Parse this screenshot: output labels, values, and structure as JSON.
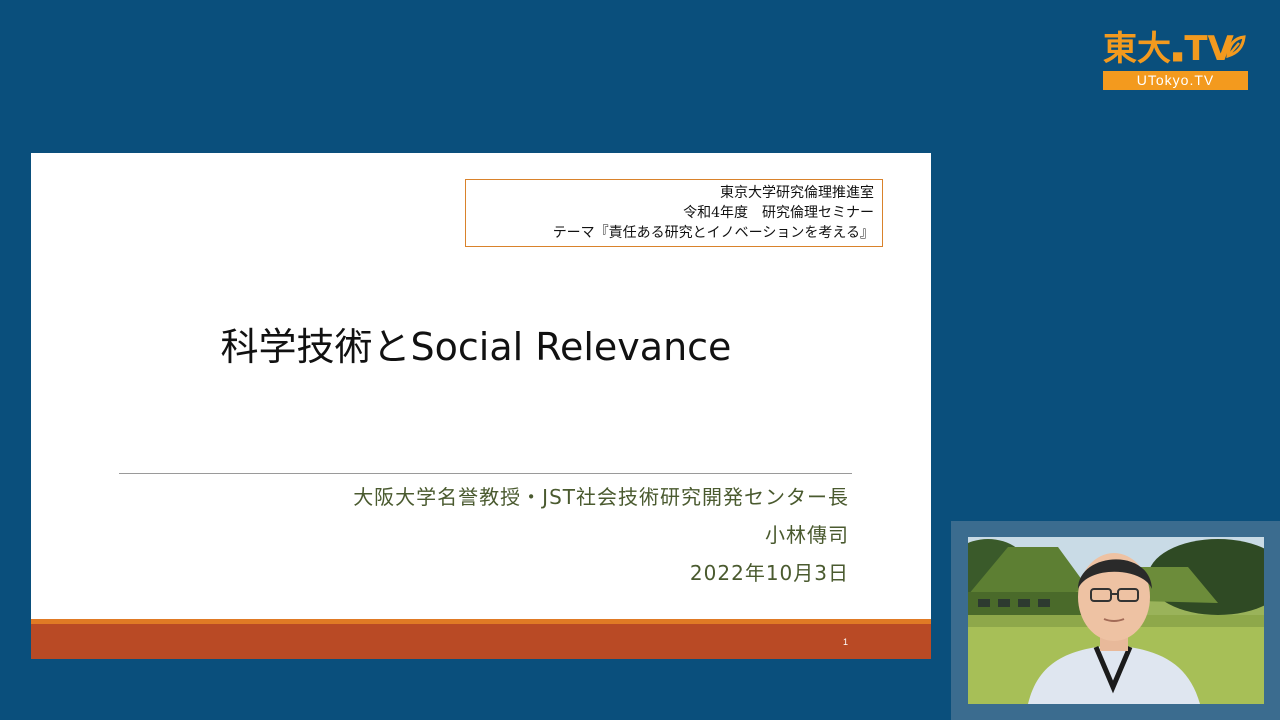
{
  "logo": {
    "main_text": "東大.TV",
    "main_prefix": "東大",
    "main_dots": "■",
    "main_suffix": "TV",
    "sub_text": "UTokyo.TV"
  },
  "slide": {
    "header_box": {
      "line1": "東京大学研究倫理推進室",
      "line2": "令和4年度　研究倫理セミナー",
      "line3": "テーマ『責任ある研究とイノベーションを考える』"
    },
    "title": "科学技術とSocial Relevance",
    "presenter": {
      "affiliation": "大阪大学名誉教授・JST社会技術研究開発センター長",
      "name": "小林傳司",
      "date": "2022年10月3日"
    },
    "page_number": "1"
  },
  "colors": {
    "background": "#0a4f7c",
    "logo_orange": "#f39a1e",
    "header_border": "#d9822b",
    "footer_orange": "#e07a25",
    "footer_rust": "#b94a25",
    "presenter_text": "#4a5a2f"
  },
  "webcam": {
    "label": "presenter-webcam-feed"
  }
}
